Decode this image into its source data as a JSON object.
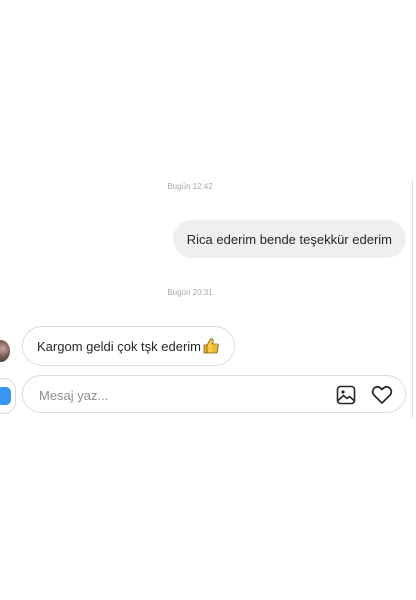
{
  "messages": [
    {
      "type": "timestamp",
      "text": "Bugün 12:42"
    },
    {
      "type": "outgoing",
      "text": "Rica ederim bende teşekkür ederim"
    },
    {
      "type": "timestamp",
      "text": "Bugün 20:31"
    },
    {
      "type": "incoming",
      "text": "Kargom geldi çok tşk ederim",
      "emoji": "thumbs-up-icon"
    }
  ],
  "composer": {
    "placeholder": "Mesaj yaz...",
    "value": "",
    "image_icon": "image-icon",
    "heart_icon": "heart-icon"
  },
  "colors": {
    "accent": "#3797f0",
    "outgoing_bubble": "#efefef",
    "border": "#dbdbdb",
    "timestamp": "#a8a8a8",
    "text": "#262626",
    "thumbs": "#f2b824"
  }
}
